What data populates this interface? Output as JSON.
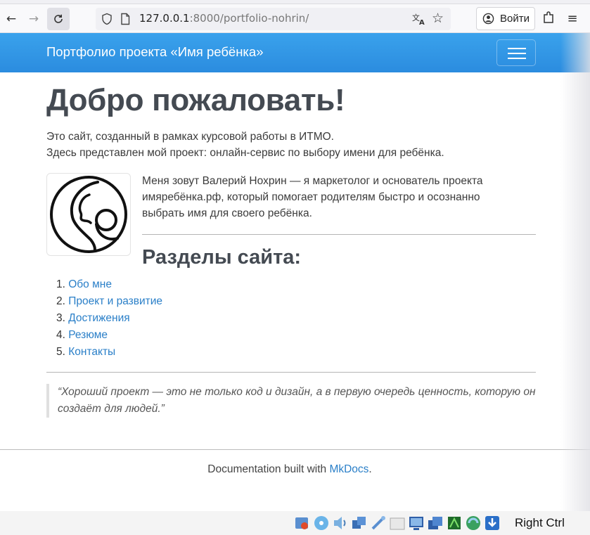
{
  "browser": {
    "url_host": "127.0.0.1",
    "url_rest": ":8000/portfolio-nohrin/",
    "signin_label": "Войти",
    "icons": [
      "back-icon",
      "forward-icon",
      "reload-icon",
      "shield-icon",
      "page-icon",
      "translate-icon",
      "star-icon",
      "account-icon",
      "extensions-icon",
      "menu-icon"
    ]
  },
  "navbar": {
    "brand": "Портфолио проекта «Имя ребёнка»"
  },
  "main": {
    "title": "Добро пожаловать!",
    "intro_line1": "Это сайт, созданный в рамках курсовой работы в ИТМО.",
    "intro_line2": "Здесь представлен мой проект: онлайн-сервис по выбору имени для ребёнка.",
    "bio": "Меня зовут Валерий Нохрин — я маркетолог и основатель проекта имяребёнка.рф, который помогает родителям быстро и осознанно выбрать имя для своего ребёнка.",
    "sections_heading": "Разделы сайта:",
    "sections": [
      {
        "num": "1.",
        "label": "Обо мне"
      },
      {
        "num": "2.",
        "label": "Проект и развитие"
      },
      {
        "num": "3.",
        "label": "Достижения"
      },
      {
        "num": "4.",
        "label": "Резюме"
      },
      {
        "num": "5.",
        "label": "Контакты"
      }
    ],
    "quote": "“Хороший проект — это не только код и дизайн, а в первую очередь ценность, которую он создаёт для людей.”"
  },
  "footer": {
    "text_before": "Documentation built with ",
    "link": "MkDocs",
    "text_after": "."
  },
  "vbox": {
    "host_key": "Right Ctrl"
  },
  "colors": {
    "navbar": "#2b8cdf",
    "link": "#2a7fc8",
    "heading": "#444a52"
  }
}
